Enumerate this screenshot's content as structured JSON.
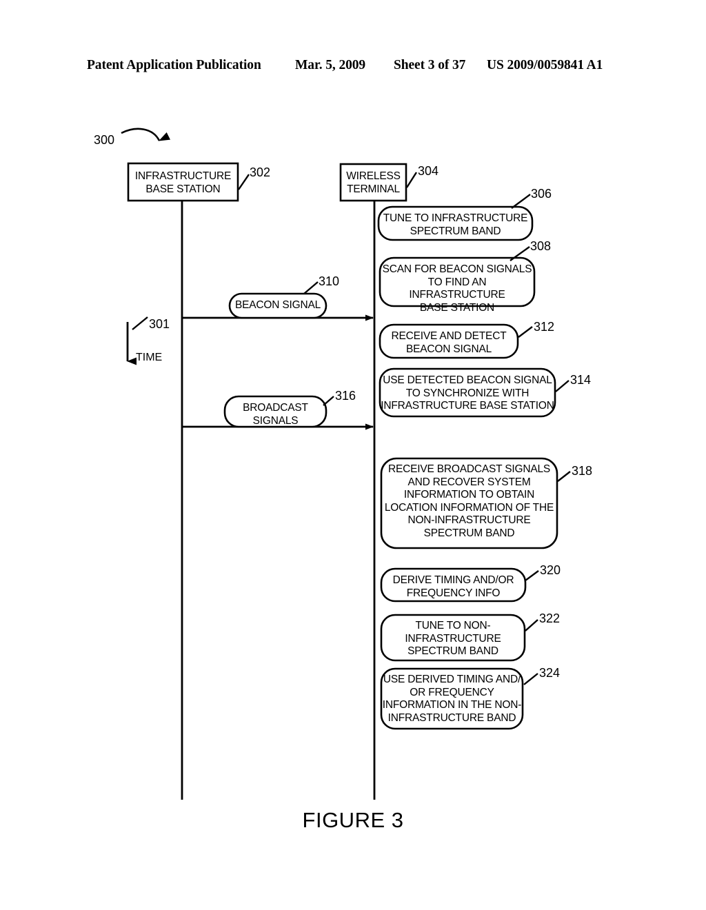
{
  "header": {
    "publication": "Patent Application Publication",
    "date": "Mar. 5, 2009",
    "sheet": "Sheet 3 of 37",
    "patent_number": "US 2009/0059841 A1"
  },
  "figure": {
    "caption": "FIGURE 3",
    "diagram_ref": "300",
    "time_axis_ref": "301",
    "time_axis_label": "TIME"
  },
  "endpoints": [
    {
      "ref": "302",
      "label": "INFRASTRUCTURE\nBASE STATION"
    },
    {
      "ref": "304",
      "label": "WIRELESS\nTERMINAL"
    }
  ],
  "messages": [
    {
      "ref": "310",
      "label": "BEACON SIGNAL"
    },
    {
      "ref": "316",
      "label": "BROADCAST\nSIGNALS"
    }
  ],
  "steps": [
    {
      "ref": "306",
      "label": "TUNE TO INFRASTRUCTURE\nSPECTRUM BAND"
    },
    {
      "ref": "308",
      "label": "SCAN FOR BEACON SIGNALS\nTO FIND AN INFRASTRUCTURE\nBASE STATION"
    },
    {
      "ref": "312",
      "label": "RECEIVE AND DETECT\nBEACON SIGNAL"
    },
    {
      "ref": "314",
      "label": "USE DETECTED BEACON SIGNAL\nTO SYNCHRONIZE WITH\nINFRASTRUCTURE BASE STATION"
    },
    {
      "ref": "318",
      "label": "RECEIVE BROADCAST SIGNALS\nAND RECOVER SYSTEM\nINFORMATION TO OBTAIN\nLOCATION INFORMATION OF THE\nNON-INFRASTRUCTURE\nSPECTRUM BAND"
    },
    {
      "ref": "320",
      "label": "DERIVE TIMING AND/OR\nFREQUENCY INFO"
    },
    {
      "ref": "322",
      "label": "TUNE TO NON-\nINFRASTRUCTURE\nSPECTRUM BAND"
    },
    {
      "ref": "324",
      "label": "USE DERIVED TIMING AND/\nOR FREQUENCY\nINFORMATION IN THE NON-\nINFRASTRUCTURE BAND"
    }
  ],
  "style": {
    "ink": "#000000",
    "paper": "#ffffff"
  }
}
